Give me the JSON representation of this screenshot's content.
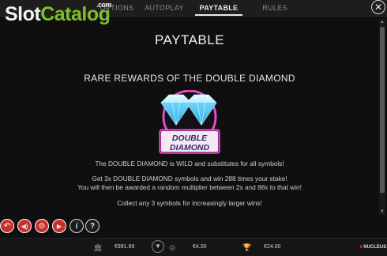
{
  "tabs": [
    {
      "label": "OPTIONS",
      "active": false
    },
    {
      "label": "AUTOPLAY",
      "active": false
    },
    {
      "label": "PAYTABLE",
      "active": true
    },
    {
      "label": "RULES",
      "active": false
    }
  ],
  "watermark": {
    "part1": "Slot",
    "part2": "Catalog",
    "suffix": ".com"
  },
  "close_icon": "close-icon",
  "paytable": {
    "title": "PAYTABLE",
    "section_title": "RARE REWARDS OF THE DOUBLE DIAMOND",
    "symbol": {
      "line1": "DOUBLE",
      "line2": "DIAMOND"
    },
    "lines": [
      "The DOUBLE DIAMOND is WILD and substitutes for all symbols!",
      "Get 3x DOUBLE DIAMOND symbols and win 288 times your stake!",
      "You will then be awarded a random multiplier between 2x and 88x to that win!",
      "Collect any 3 symbols for increasingly larger wins!"
    ]
  },
  "controls": [
    {
      "name": "back-icon",
      "glyph": "↶"
    },
    {
      "name": "sound-icon",
      "glyph": "🔊"
    },
    {
      "name": "gear-icon",
      "glyph": "⚙"
    },
    {
      "name": "play-icon",
      "glyph": "▶"
    },
    {
      "name": "info-icon",
      "glyph": "i"
    },
    {
      "name": "help-icon",
      "glyph": "?"
    }
  ],
  "bottombar": {
    "balance": "€991.99",
    "bet": "€4.00",
    "win": "€24.00",
    "brand": "NUCLEUS"
  },
  "colors": {
    "accent_red": "#e0322c",
    "logo_green": "#7fbe2a",
    "active_tab": "#e8e8e8"
  }
}
